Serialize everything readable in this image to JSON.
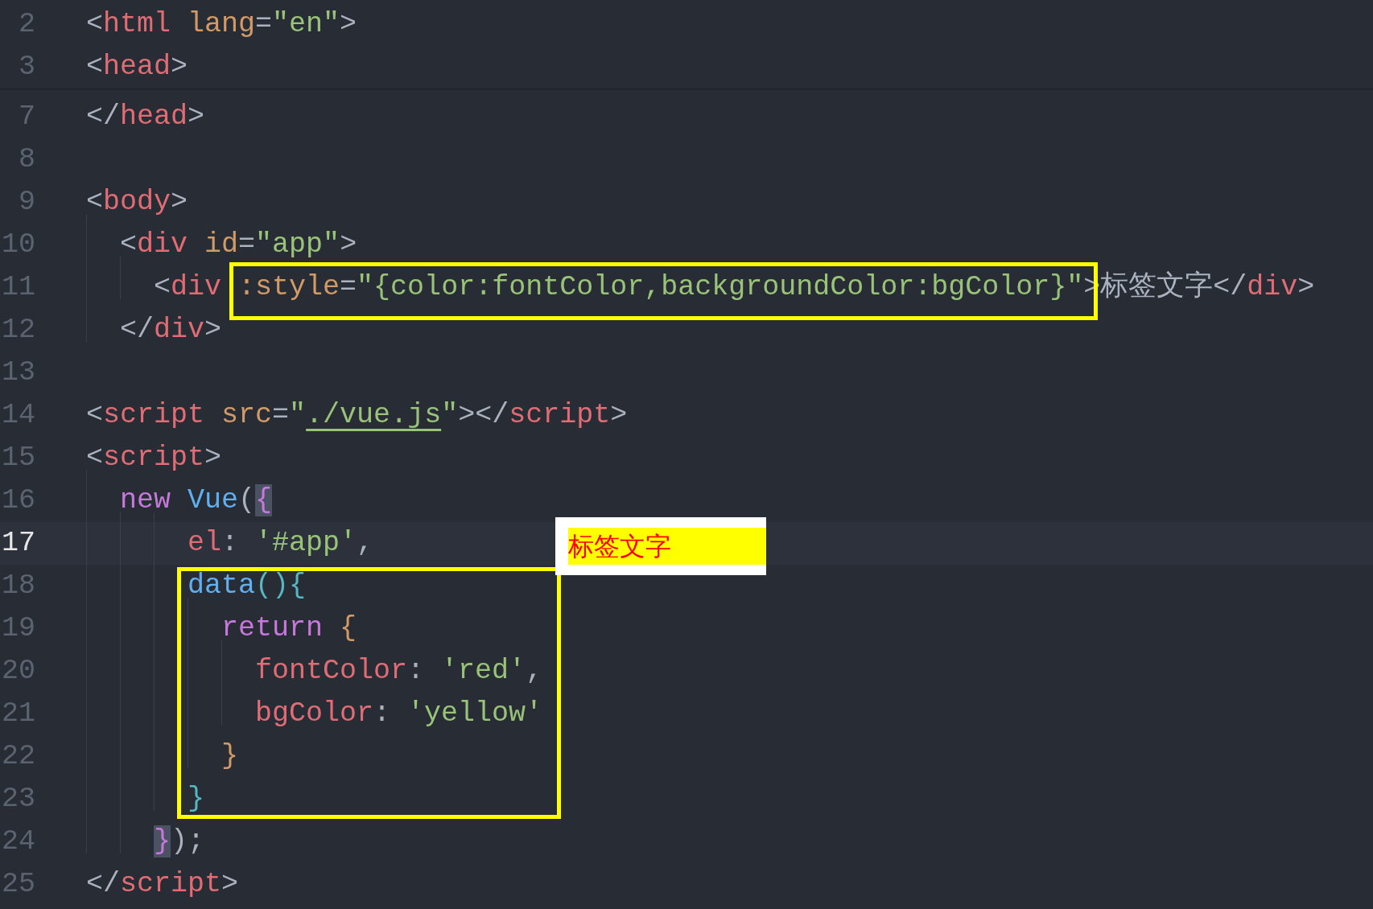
{
  "editor": {
    "lines": [
      {
        "number": "2",
        "current": false,
        "tokens": [
          {
            "text": "<",
            "kind": "punct"
          },
          {
            "text": "html",
            "kind": "tag"
          },
          {
            "text": " lang",
            "kind": "attr"
          },
          {
            "text": "=",
            "kind": "punct"
          },
          {
            "text": "\"en\"",
            "kind": "str"
          },
          {
            "text": ">",
            "kind": "punct"
          }
        ]
      },
      {
        "number": "3",
        "current": false,
        "fold_after": true,
        "tokens": [
          {
            "text": "<",
            "kind": "punct"
          },
          {
            "text": "head",
            "kind": "tag"
          },
          {
            "text": ">",
            "kind": "punct"
          }
        ]
      },
      {
        "number": "7",
        "current": false,
        "tokens": [
          {
            "text": "</",
            "kind": "punct"
          },
          {
            "text": "head",
            "kind": "tag"
          },
          {
            "text": ">",
            "kind": "punct"
          }
        ]
      },
      {
        "number": "8",
        "current": false
      },
      {
        "number": "9",
        "current": false,
        "tokens": [
          {
            "text": "<",
            "kind": "punct"
          },
          {
            "text": "body",
            "kind": "tag"
          },
          {
            "text": ">",
            "kind": "punct"
          }
        ]
      },
      {
        "number": "10",
        "current": false,
        "tokens": [
          {
            "text": "  <",
            "kind": "punct"
          },
          {
            "text": "div",
            "kind": "tag"
          },
          {
            "text": " id",
            "kind": "attr"
          },
          {
            "text": "=",
            "kind": "punct"
          },
          {
            "text": "\"app\"",
            "kind": "str"
          },
          {
            "text": ">",
            "kind": "punct"
          }
        ]
      },
      {
        "number": "11",
        "current": false,
        "tokens": [
          {
            "text": "    <",
            "kind": "punct"
          },
          {
            "text": "div",
            "kind": "tag"
          },
          {
            "text": " :style",
            "kind": "attr"
          },
          {
            "text": "=",
            "kind": "punct"
          },
          {
            "text": "\"{color:fontColor,backgroundColor:bgColor}\"",
            "kind": "str"
          },
          {
            "text": ">",
            "kind": "punct"
          },
          {
            "text": "标签文字",
            "kind": "plain"
          },
          {
            "text": "</",
            "kind": "punct"
          },
          {
            "text": "div",
            "kind": "tag"
          },
          {
            "text": ">",
            "kind": "punct"
          }
        ]
      },
      {
        "number": "12",
        "current": false,
        "tokens": [
          {
            "text": "  </",
            "kind": "punct"
          },
          {
            "text": "div",
            "kind": "tag"
          },
          {
            "text": ">",
            "kind": "punct"
          }
        ]
      },
      {
        "number": "13",
        "current": false
      },
      {
        "number": "14",
        "current": false,
        "tokens": [
          {
            "text": "<",
            "kind": "punct"
          },
          {
            "text": "script",
            "kind": "tag"
          },
          {
            "text": " src",
            "kind": "attr"
          },
          {
            "text": "=",
            "kind": "punct"
          },
          {
            "text": "\"",
            "kind": "str"
          },
          {
            "text": "./vue.js",
            "kind": "link"
          },
          {
            "text": "\"",
            "kind": "str"
          },
          {
            "text": "></",
            "kind": "punct"
          },
          {
            "text": "script",
            "kind": "tag"
          },
          {
            "text": ">",
            "kind": "punct"
          }
        ]
      },
      {
        "number": "15",
        "current": false,
        "tokens": [
          {
            "text": "<",
            "kind": "punct"
          },
          {
            "text": "script",
            "kind": "tag"
          },
          {
            "text": ">",
            "kind": "punct"
          }
        ]
      },
      {
        "number": "16",
        "current": false,
        "tokens": [
          {
            "text": "  new",
            "kind": "kw"
          },
          {
            "text": " Vue",
            "kind": "fn"
          },
          {
            "text": "(",
            "kind": "punct"
          },
          {
            "text": "{",
            "kind": "match"
          }
        ]
      },
      {
        "number": "17",
        "current": true,
        "tokens": [
          {
            "text": "      el",
            "kind": "prop"
          },
          {
            "text": ": ",
            "kind": "punct"
          },
          {
            "text": "'#app'",
            "kind": "str"
          },
          {
            "text": ",",
            "kind": "punct"
          }
        ]
      },
      {
        "number": "18",
        "current": false,
        "tokens": [
          {
            "text": "      data",
            "kind": "fn"
          },
          {
            "text": "(){",
            "kind": "brace"
          }
        ]
      },
      {
        "number": "19",
        "current": false,
        "tokens": [
          {
            "text": "        return",
            "kind": "kw"
          },
          {
            "text": " {",
            "kind": "obrace"
          }
        ]
      },
      {
        "number": "20",
        "current": false,
        "tokens": [
          {
            "text": "          fontColor",
            "kind": "prop"
          },
          {
            "text": ": ",
            "kind": "punct"
          },
          {
            "text": "'red'",
            "kind": "str"
          },
          {
            "text": ",",
            "kind": "punct"
          }
        ]
      },
      {
        "number": "21",
        "current": false,
        "tokens": [
          {
            "text": "          bgColor",
            "kind": "prop"
          },
          {
            "text": ": ",
            "kind": "punct"
          },
          {
            "text": "'yellow'",
            "kind": "str"
          }
        ]
      },
      {
        "number": "22",
        "current": false,
        "tokens": [
          {
            "text": "        }",
            "kind": "obrace"
          }
        ]
      },
      {
        "number": "23",
        "current": false,
        "tokens": [
          {
            "text": "      }",
            "kind": "brace"
          }
        ]
      },
      {
        "number": "24",
        "current": false,
        "tokens": [
          {
            "text": "    }",
            "kind": "match"
          },
          {
            "text": ");",
            "kind": "punct"
          }
        ]
      },
      {
        "number": "25",
        "current": false,
        "tokens": [
          {
            "text": "</",
            "kind": "punct"
          },
          {
            "text": "script",
            "kind": "tag"
          },
          {
            "text": ">",
            "kind": "punct"
          }
        ]
      }
    ]
  },
  "preview": {
    "text": "标签文字"
  }
}
